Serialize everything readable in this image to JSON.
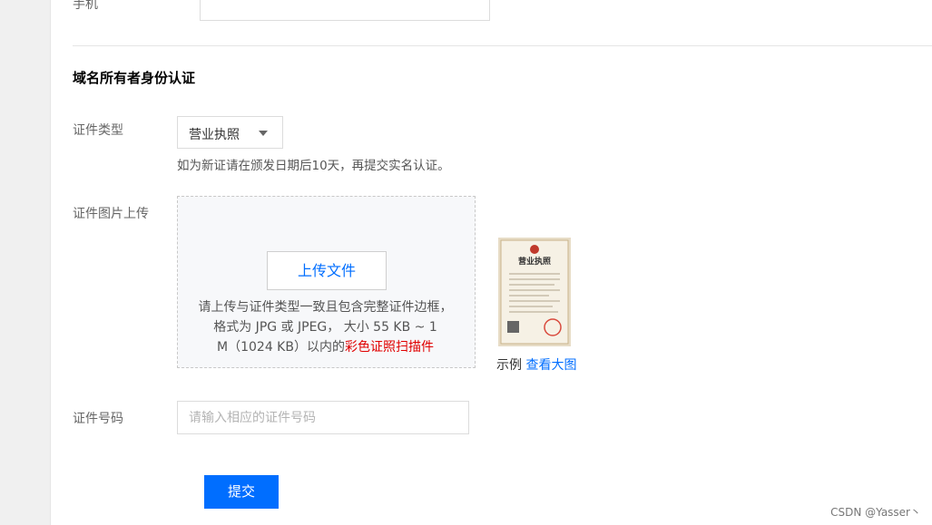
{
  "contact": {
    "phone_label": "手机",
    "phone_value": ""
  },
  "section": {
    "title": "域名所有者身份认证"
  },
  "form": {
    "id_type_label": "证件类型",
    "id_type_selected": "营业执照",
    "id_type_hint": "如为新证请在颁发日期后10天，再提交实名认证。",
    "upload_label": "证件图片上传",
    "upload_button": "上传文件",
    "upload_desc_line1": "请上传与证件类型一致且包含完整证件边框，",
    "upload_desc_line2": "格式为 JPG 或 JPEG， 大小 55 KB ~ 1",
    "upload_desc_line3": "M（1024 KB）以内的",
    "upload_desc_highlight": "彩色证照扫描件",
    "sample_caption": "示例",
    "sample_view_link": "查看大图",
    "sample_title": "营业执照",
    "id_number_label": "证件号码",
    "id_number_placeholder": "请输入相应的证件号码",
    "id_number_value": "",
    "submit_button": "提交"
  },
  "watermark": "CSDN @Yasser丶",
  "colors": {
    "primary": "#006eff",
    "highlight_red": "#e00000"
  }
}
